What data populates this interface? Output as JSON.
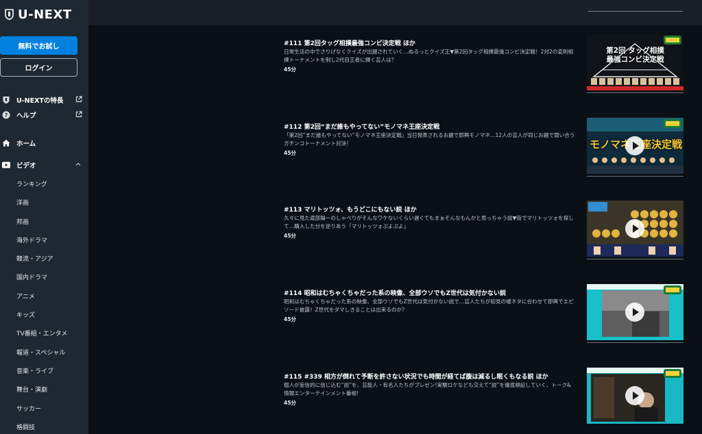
{
  "brand": {
    "name": "U-NEXT"
  },
  "sidebar": {
    "trial_button": "無料でお試し",
    "login_button": "ログイン",
    "info_links": [
      {
        "label": "U-NEXTの特長",
        "icon": "unext-shield-icon"
      },
      {
        "label": "ヘルプ",
        "icon": "help-icon"
      }
    ],
    "home": {
      "label": "ホーム",
      "icon": "home-icon"
    },
    "video": {
      "label": "ビデオ",
      "icon": "video-icon"
    },
    "video_items": [
      "ランキング",
      "洋画",
      "邦画",
      "海外ドラマ",
      "韓流・アジア",
      "国内ドラマ",
      "アニメ",
      "キッズ",
      "TV番組・エンタメ",
      "報道・スペシャル",
      "音楽・ライブ",
      "舞台・演劇",
      "サッカー",
      "格闘技"
    ]
  },
  "episodes": [
    {
      "title": "#111 第2回タッグ相撲最強コンビ決定戦 ほか",
      "description": "日常生活の中でさりげなくクイズが出題されていく…ぬるっとクイズ王▼第2回タッグ相撲最強コンビ決定戦！2対2の変則相撲トーナメントを制し2代目王者に輝く芸人は？",
      "duration": "45分",
      "thumb_text": "第2回 タッグ相撲 最強コンビ決定戦",
      "thumb_colors": {
        "bg": "#111418",
        "accent": "#f2d23a"
      }
    },
    {
      "title": "#112 第2回“まだ誰もやってない”モノマネ王座決定戦",
      "description": "「第2回“まだ誰もやってない”モノマネ王座決定戦」当日発表されるお題で即興モノマネ…12人の芸人が同じお題で競い合うガチンコトーナメント対決！",
      "duration": "45分",
      "thumb_text": "モノマネ王座決定戦",
      "thumb_colors": {
        "bg": "#0f2a3a",
        "accent": "#f6c933"
      }
    },
    {
      "title": "#113 マリトッツォ、もうどこにもない説 ほか",
      "description": "久々に見た渡部陽一のしゃべりがそんなワケないくらい遅くてもまぁそんなもんかと思っちゃう説▼街でマリトッツォを探して…購入した分を逆りあう「マリトッツォぷよぷよ」",
      "duration": "45分",
      "thumb_text": "",
      "thumb_colors": {
        "bg": "#3b3528",
        "accent": "#e2b440"
      }
    },
    {
      "title": "#114 昭和はむちゃくちゃだった系の映像、全部ウソでもZ世代は気付かない説",
      "description": "昭和はむちゃくちゃだった系の映像、全部ウソでもZ世代は気付かない説で…芸人たちが初見の嘘ネタに合わせて即興でエピソード披露！Z世代をダマしきることは出来るのか？",
      "duration": "45分",
      "thumb_text": "",
      "thumb_colors": {
        "bg": "#18c0c9",
        "accent": "#6a6a6a"
      }
    },
    {
      "title": "#115 #339 相方が倒れて予断を許さない状況でも時間が経てば腹は減るし眠くもなる説 ほか",
      "description": "個人が妄信的に信じ込む“説”を、芸能人・有名人たちがプレゼン!実験ロケなども交えて“説”を徹底検証していく、トーク&情報エンターテインメント番組!",
      "duration": "45分",
      "thumb_text": "",
      "thumb_colors": {
        "bg": "#18b8c4",
        "accent": "#2a2620"
      }
    }
  ]
}
